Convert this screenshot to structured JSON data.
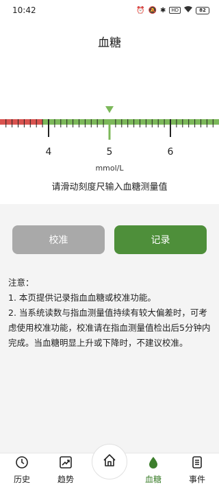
{
  "status_bar": {
    "time": "10:42",
    "icons": [
      "alarm-icon",
      "mute-icon",
      "bluetooth-icon",
      "hd-icon",
      "wifi-icon"
    ],
    "hd_label": "HD",
    "battery": "82"
  },
  "header": {
    "title": "血糖"
  },
  "ruler": {
    "tick_labels": [
      "4",
      "5",
      "6"
    ],
    "current_value": 5.0,
    "min_visible": 3.0,
    "max_visible": 6.8,
    "low_threshold": 3.9,
    "low_color": "#d9534f",
    "normal_color": "#7cb85a",
    "unit": "mmol/L",
    "hint": "请滑动刻度尺输入血糖测量值"
  },
  "buttons": {
    "calibrate_label": "校准",
    "record_label": "记录"
  },
  "notes": {
    "heading": "注意：",
    "item1": "1. 本页提供记录指血血糖或校准功能。",
    "item2": "2. 当系统读数与指血测量值持续有较大偏差时，可考虑使用校准功能，校准请在指血测量值检出后5分钟内完成。当血糖明显上升或下降时，不建议校准。"
  },
  "tabs": [
    {
      "label": "历史",
      "icon": "clock-icon"
    },
    {
      "label": "趋势",
      "icon": "trend-icon"
    },
    {
      "label": "",
      "icon": "home-icon"
    },
    {
      "label": "血糖",
      "icon": "drop-icon"
    },
    {
      "label": "事件",
      "icon": "document-icon"
    }
  ],
  "colors": {
    "accent": "#4e8f3a",
    "active_tab": "#3d7f2d",
    "disabled": "#a9a9a9"
  }
}
